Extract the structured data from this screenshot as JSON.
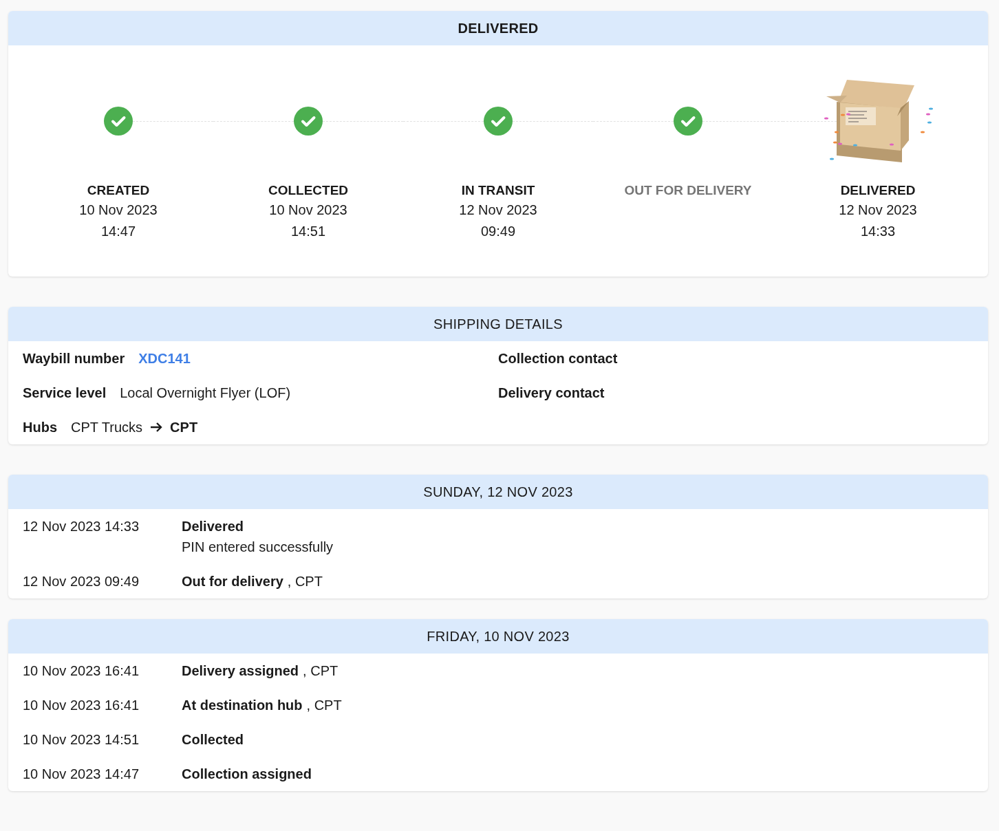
{
  "status_card": {
    "title": "DELIVERED",
    "steps": [
      {
        "kind": "check",
        "label": "CREATED",
        "date": "10 Nov 2023",
        "time": "14:47",
        "dimmed": false
      },
      {
        "kind": "check",
        "label": "COLLECTED",
        "date": "10 Nov 2023",
        "time": "14:51",
        "dimmed": false
      },
      {
        "kind": "check",
        "label": "IN TRANSIT",
        "date": "12 Nov 2023",
        "time": "09:49",
        "dimmed": false
      },
      {
        "kind": "check",
        "label": "OUT FOR DELIVERY",
        "dimmed": true
      },
      {
        "kind": "box",
        "label": "DELIVERED",
        "date": "12 Nov 2023",
        "time": "14:33",
        "dimmed": false
      }
    ]
  },
  "shipping_details": {
    "title": "SHIPPING DETAILS",
    "waybill": {
      "label": "Waybill number",
      "value": "XDC141"
    },
    "service_level": {
      "label": "Service level",
      "value": "Local Overnight Flyer (LOF)"
    },
    "hubs": {
      "label": "Hubs",
      "from": "CPT Trucks",
      "to": "CPT"
    },
    "collection_contact": {
      "label": "Collection contact"
    },
    "delivery_contact": {
      "label": "Delivery contact"
    }
  },
  "days": [
    {
      "title": "SUNDAY, 12 NOV 2023",
      "events": [
        {
          "time": "12 Nov 2023 14:33",
          "title": "Delivered",
          "note": "PIN entered successfully"
        },
        {
          "time": "12 Nov 2023 09:49",
          "title": "Out for delivery",
          "suffix": ", CPT"
        }
      ]
    },
    {
      "title": "FRIDAY, 10 NOV 2023",
      "events": [
        {
          "time": "10 Nov 2023 16:41",
          "title": "Delivery assigned",
          "suffix": ", CPT"
        },
        {
          "time": "10 Nov 2023 16:41",
          "title": "At destination hub",
          "suffix": ", CPT"
        },
        {
          "time": "10 Nov 2023 14:51",
          "title": "Collected"
        },
        {
          "time": "10 Nov 2023 14:47",
          "title": "Collection assigned"
        }
      ]
    }
  ]
}
